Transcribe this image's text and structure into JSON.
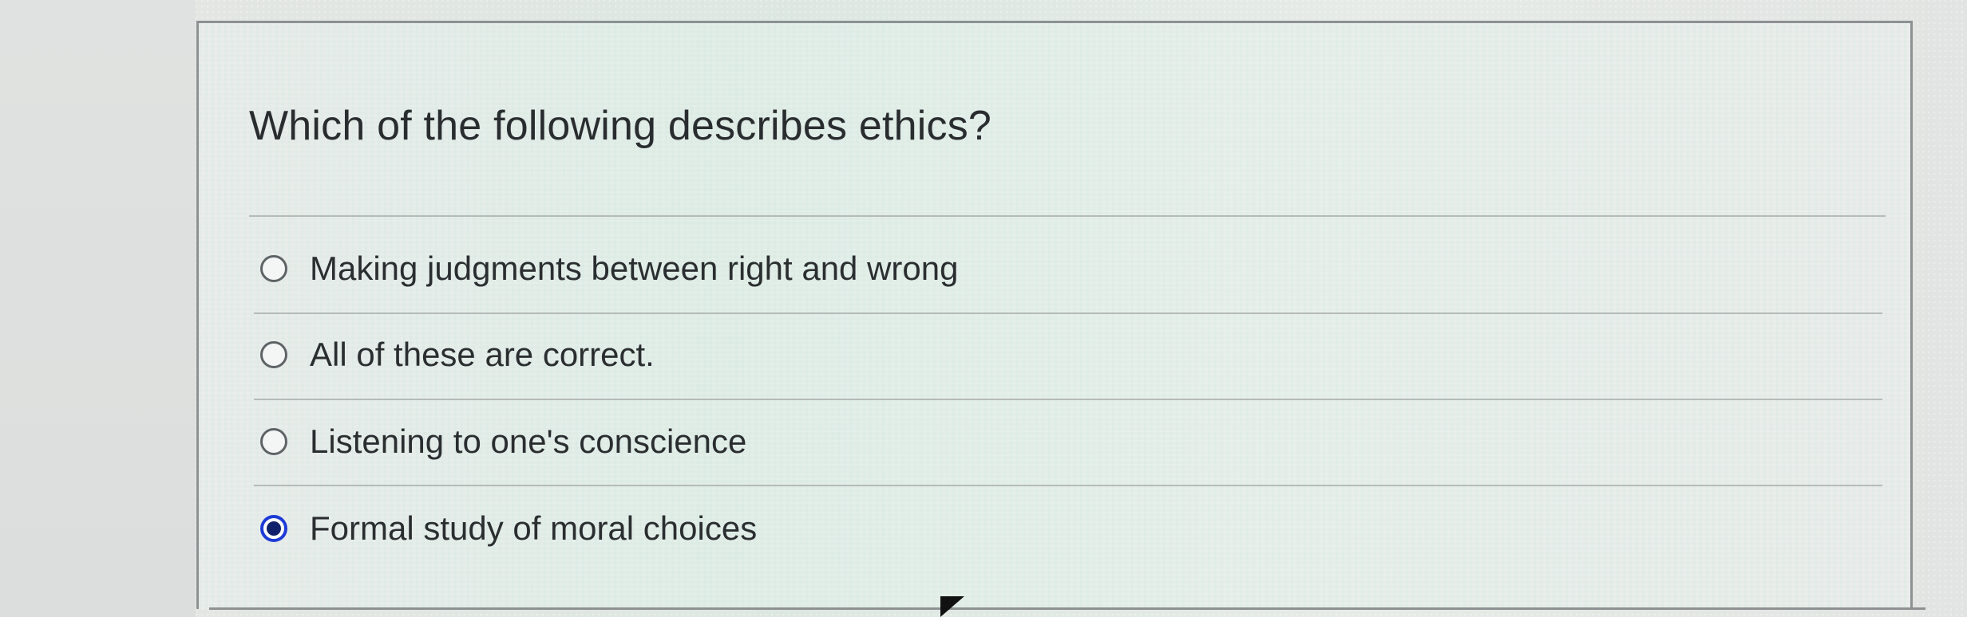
{
  "question": {
    "text": "Which of the following describes ethics?"
  },
  "answers": [
    {
      "label": "Making judgments between right and wrong",
      "selected": false
    },
    {
      "label": "All of these are correct.",
      "selected": false
    },
    {
      "label": "Listening to one's conscience",
      "selected": false
    },
    {
      "label": "Formal study of moral choices",
      "selected": true
    }
  ],
  "colors": {
    "selected_radio": "#1d3bd6",
    "text": "#2b2e30",
    "border": "#8d9192"
  }
}
